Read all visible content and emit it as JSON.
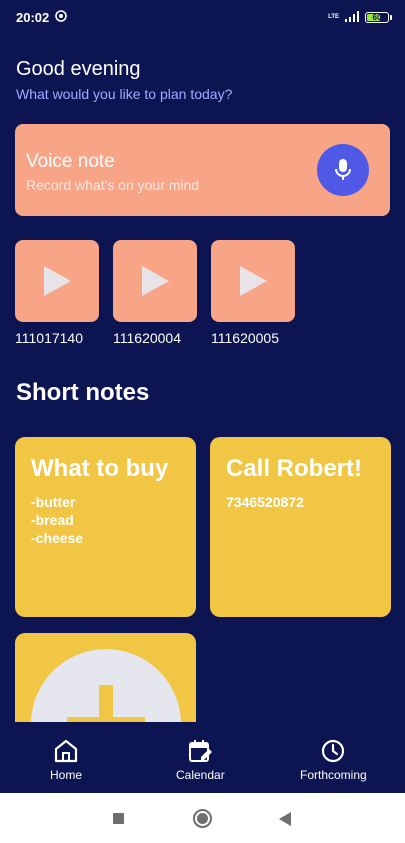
{
  "status_bar": {
    "time": "20:02",
    "network": "LTE",
    "battery_level": "60",
    "battery_color": "#9be33a"
  },
  "header": {
    "greeting": "Good evening",
    "subtitle": "What would you like to plan today?"
  },
  "voice_note": {
    "title": "Voice note",
    "subtitle": "Record what's on your mind",
    "icon": "microphone-icon"
  },
  "recordings": [
    {
      "label": "111017140",
      "icon": "play-icon"
    },
    {
      "label": "111620004",
      "icon": "play-icon"
    },
    {
      "label": "111620005",
      "icon": "play-icon"
    }
  ],
  "short_notes": {
    "title": "Short notes",
    "notes": [
      {
        "title": "What to buy",
        "body": [
          "-butter",
          "-bread",
          "-cheese"
        ]
      },
      {
        "title": "Call Robert!",
        "body": [
          "7346520872"
        ]
      }
    ],
    "add_icon": "plus-icon"
  },
  "nav": [
    {
      "label": "Home",
      "icon": "home-icon"
    },
    {
      "label": "Calendar",
      "icon": "calendar-edit-icon"
    },
    {
      "label": "Forthcoming",
      "icon": "clock-icon"
    }
  ],
  "colors": {
    "background": "#0c1552",
    "voice_card": "#f8a487",
    "mic_button": "#5059e6",
    "note_card": "#f1c644",
    "subtitle": "#a5a8ff"
  }
}
